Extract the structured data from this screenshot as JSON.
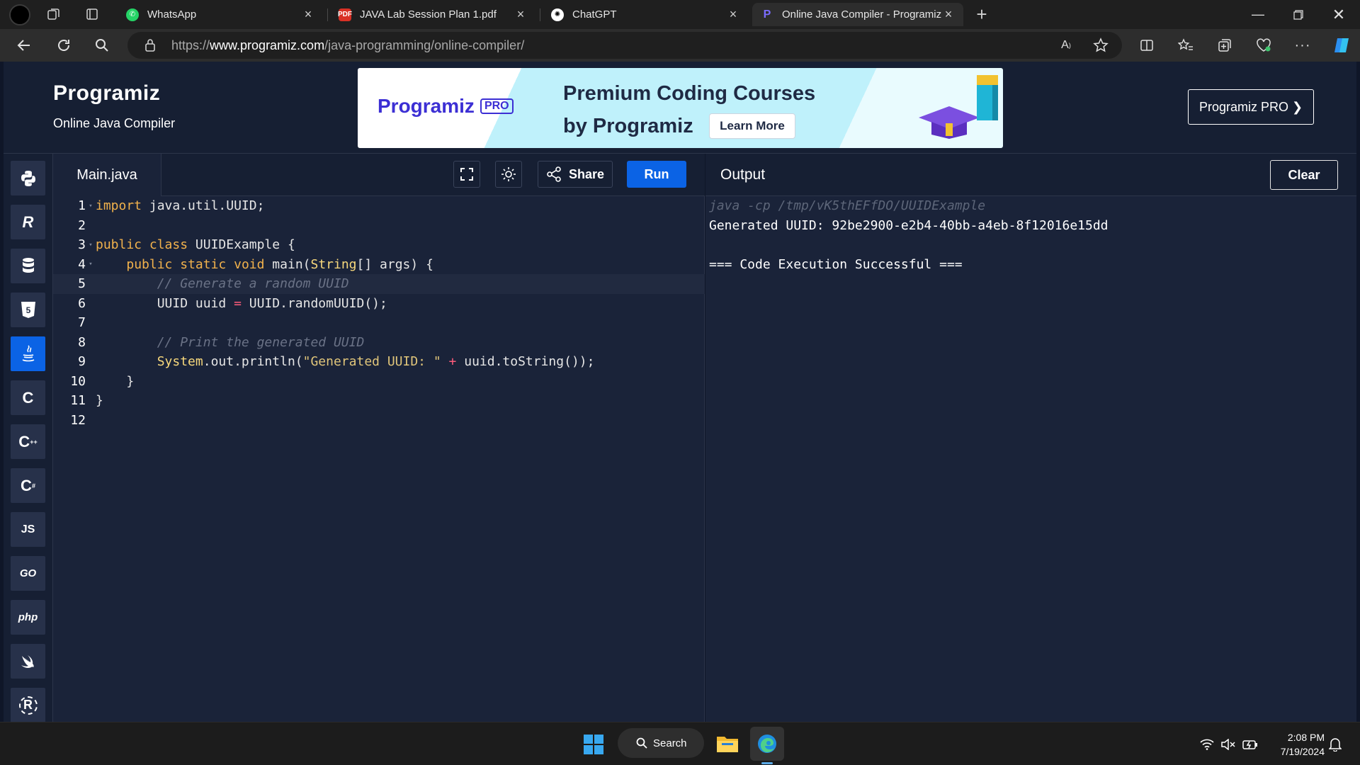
{
  "browser": {
    "tabs": [
      {
        "title": "WhatsApp",
        "favicon": "whatsapp-icon"
      },
      {
        "title": "JAVA Lab Session Plan 1.pdf",
        "favicon": "pdf-icon"
      },
      {
        "title": "ChatGPT",
        "favicon": "chatgpt-icon"
      },
      {
        "title": "Online Java Compiler - Programiz",
        "favicon": "programiz-icon",
        "active": true
      }
    ],
    "url_prefix": "https://",
    "url_domain": "www.programiz.com",
    "url_path": "/java-programming/online-compiler/"
  },
  "header": {
    "logo": "Programiz",
    "subtitle": "Online Java Compiler",
    "pro_button": "Programiz PRO ❯"
  },
  "ad": {
    "logo": "Programiz",
    "badge": "PRO",
    "line1": "Premium Coding Courses",
    "line2": "by Programiz",
    "cta": "Learn More"
  },
  "sidebar": {
    "languages": [
      {
        "name": "python",
        "label": "",
        "icon": "python-icon"
      },
      {
        "name": "r",
        "label": "R",
        "icon": "r-icon"
      },
      {
        "name": "sql",
        "label": "",
        "icon": "database-icon"
      },
      {
        "name": "html",
        "label": "5",
        "icon": "html5-icon"
      },
      {
        "name": "java",
        "label": "",
        "icon": "java-icon",
        "active": true
      },
      {
        "name": "c",
        "label": "C",
        "icon": "c-icon"
      },
      {
        "name": "cpp",
        "label": "C",
        "icon": "cpp-icon"
      },
      {
        "name": "csharp",
        "label": "C",
        "icon": "csharp-icon"
      },
      {
        "name": "js",
        "label": "JS",
        "icon": "js-icon"
      },
      {
        "name": "go",
        "label": "GO",
        "icon": "go-icon"
      },
      {
        "name": "php",
        "label": "php",
        "icon": "php-icon"
      },
      {
        "name": "swift",
        "label": "",
        "icon": "swift-icon"
      },
      {
        "name": "rust",
        "label": "R",
        "icon": "rust-icon"
      }
    ]
  },
  "editor": {
    "file_name": "Main.java",
    "share_label": "Share",
    "run_label": "Run",
    "code_lines": [
      "import java.util.UUID;",
      "",
      "public class UUIDExample {",
      "    public static void main(String[] args) {",
      "        // Generate a random UUID",
      "        UUID uuid = UUID.randomUUID();",
      "",
      "        // Print the generated UUID",
      "        System.out.println(\"Generated UUID: \" + uuid.toString());",
      "    }",
      "}",
      ""
    ]
  },
  "output": {
    "title": "Output",
    "clear_label": "Clear",
    "command": "java -cp /tmp/vK5thEFfDO/UUIDExample",
    "lines": [
      "Generated UUID: 92be2900-e2b4-40bb-a4eb-8f12016e15dd",
      "",
      "=== Code Execution Successful ==="
    ]
  },
  "taskbar": {
    "search_label": "Search",
    "time": "2:08 PM",
    "date": "7/19/2024"
  },
  "colors": {
    "run_blue": "#0b63e5",
    "page_bg": "#0f1628",
    "panel_bg": "#1a2339"
  }
}
